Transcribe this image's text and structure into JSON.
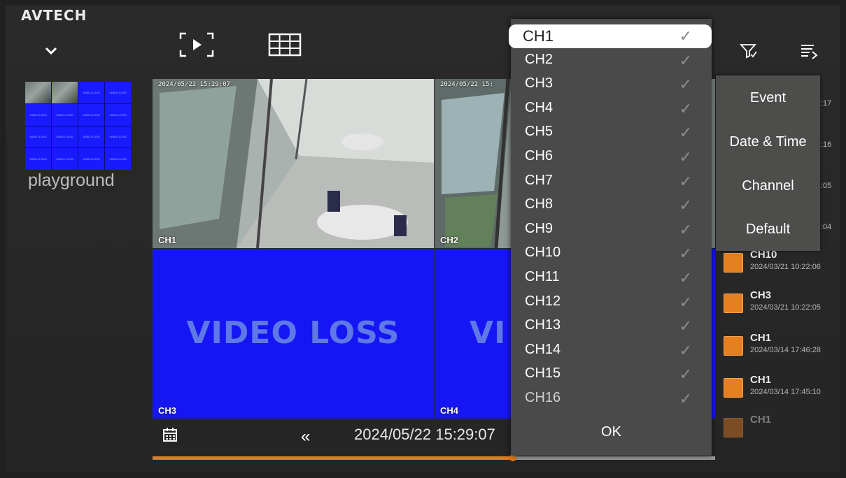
{
  "app": {
    "logo": "AVTECH"
  },
  "thumbnail": {
    "label": "playground",
    "cell_text": "VIDEO LOSS"
  },
  "video_cells": [
    {
      "timestamp": "2024/05/22 15:29:07",
      "label": "CH1"
    },
    {
      "timestamp": "2024/05/22 15:",
      "label": "CH2"
    },
    {
      "label": "CH3",
      "overlay": "VIDEO LOSS"
    },
    {
      "label": "CH4",
      "overlay": "VI"
    }
  ],
  "playback": {
    "datetime": "2024/05/22 15:29:07",
    "rewind_glyph": "«",
    "progress_fraction": 0.64
  },
  "sort_menu": {
    "items": [
      "Event",
      "Date & Time",
      "Channel",
      "Default"
    ]
  },
  "channel_selector": {
    "channels": [
      "CH1",
      "CH2",
      "CH3",
      "CH4",
      "CH5",
      "CH6",
      "CH7",
      "CH8",
      "CH9",
      "CH10",
      "CH11",
      "CH12",
      "CH13",
      "CH14",
      "CH15",
      "CH16"
    ],
    "selected": "CH1",
    "check_glyph": "✓",
    "ok_label": "OK"
  },
  "event_list": {
    "partial_times": ":17|:16|:05|:04",
    "items": [
      {
        "channel": "CH10",
        "time": "2024/03/21 10:22:06"
      },
      {
        "channel": "CH3",
        "time": "2024/03/21 10:22:05"
      },
      {
        "channel": "CH1",
        "time": "2024/03/14 17:46:28"
      },
      {
        "channel": "CH1",
        "time": "2024/03/14 17:45:10"
      },
      {
        "channel": "CH1",
        "time": ""
      }
    ]
  },
  "colors": {
    "accent": "#e07b20",
    "video_loss": "#1616f5",
    "event_icon": "#e67e22",
    "panel": "#4a4a4a"
  }
}
